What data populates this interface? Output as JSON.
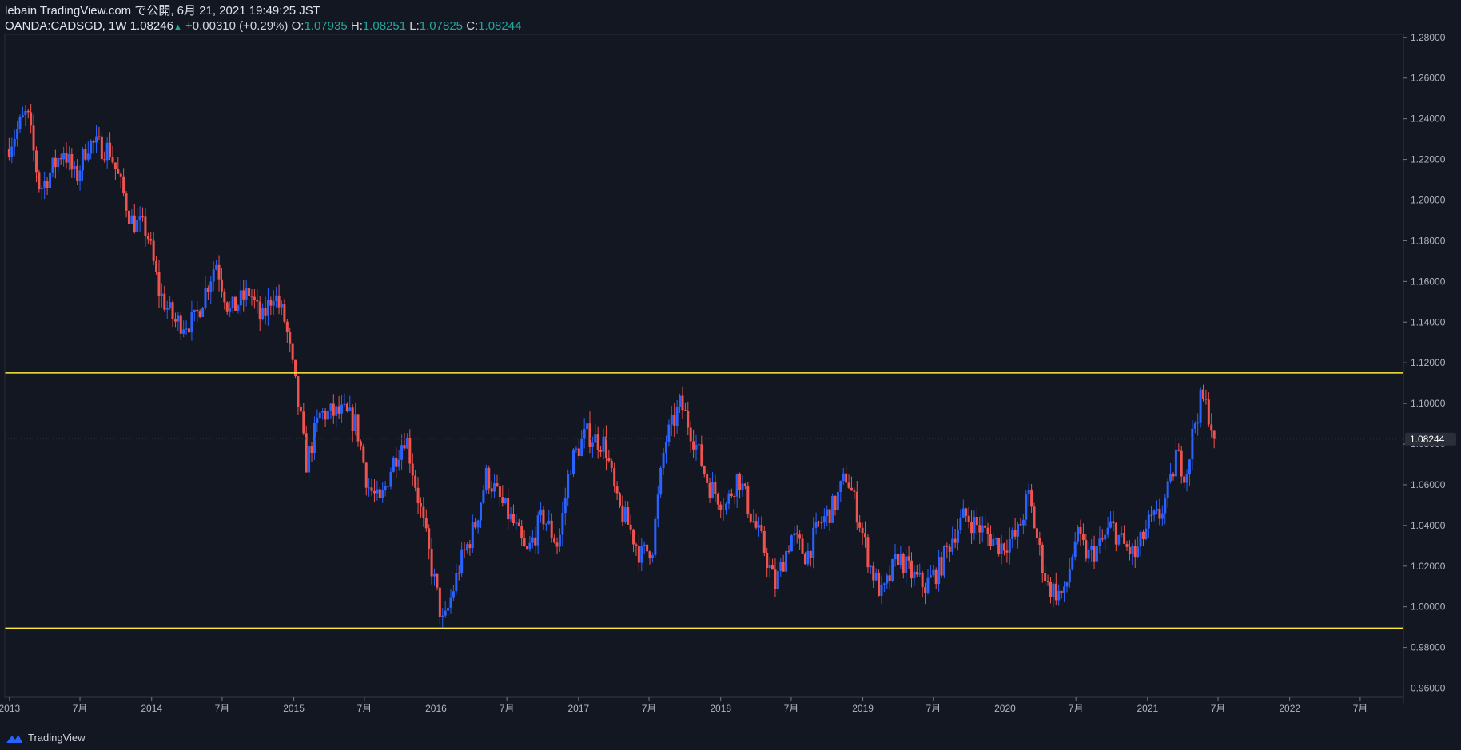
{
  "header": {
    "publish_line": "lebain TradingView.com で公開, 6月 21, 2021 19:49:25 JST",
    "symbol": "OANDA:CADSGD, 1W",
    "last": "1.08246",
    "change": "+0.00310 (+0.29%)",
    "ohlc": [
      {
        "key": "O:",
        "value": "1.07935"
      },
      {
        "key": "H:",
        "value": "1.08251"
      },
      {
        "key": "L:",
        "value": "1.07825"
      },
      {
        "key": "C:",
        "value": "1.08244"
      }
    ]
  },
  "footer": {
    "brand": "TradingView"
  },
  "colors": {
    "background": "#131722",
    "bull": "#2962ff",
    "bear": "#ef5350",
    "level_line": "#ffeb3b",
    "last_price_bg": "#2a2e39"
  },
  "chart_data": {
    "type": "candlestick",
    "x_axis": {
      "labels": [
        "2013",
        "7月",
        "2014",
        "7月",
        "2015",
        "7月",
        "2016",
        "7月",
        "2017",
        "7月",
        "2018",
        "7月",
        "2019",
        "7月",
        "2020",
        "7月",
        "2021",
        "7月",
        "2022",
        "7月"
      ],
      "range": [
        "2012-12-20",
        "2022-10-20"
      ]
    },
    "y_axis": {
      "ticks": [
        "0.96000",
        "0.98000",
        "1.00000",
        "1.02000",
        "1.04000",
        "1.06000",
        "1.08000",
        "1.10000",
        "1.12000",
        "1.14000",
        "1.16000",
        "1.18000",
        "1.20000",
        "1.22000",
        "1.24000",
        "1.26000",
        "1.28000"
      ],
      "range": [
        0.9555,
        1.2815
      ]
    },
    "horizontal_levels": [
      1.115,
      0.9895
    ],
    "last_price": "1.08244",
    "last_price_value": 1.08244,
    "price_path": [
      {
        "date": "2012-12-24",
        "price": 1.225
      },
      {
        "date": "2013-02-15",
        "price": 1.243
      },
      {
        "date": "2013-03-20",
        "price": 1.205
      },
      {
        "date": "2013-05-20",
        "price": 1.225
      },
      {
        "date": "2013-06-20",
        "price": 1.21
      },
      {
        "date": "2013-07-20",
        "price": 1.228
      },
      {
        "date": "2013-09-15",
        "price": 1.225
      },
      {
        "date": "2013-11-10",
        "price": 1.19
      },
      {
        "date": "2013-12-20",
        "price": 1.185
      },
      {
        "date": "2014-01-20",
        "price": 1.155
      },
      {
        "date": "2014-03-01",
        "price": 1.14
      },
      {
        "date": "2014-04-20",
        "price": 1.14
      },
      {
        "date": "2014-06-15",
        "price": 1.17
      },
      {
        "date": "2014-07-20",
        "price": 1.145
      },
      {
        "date": "2014-09-10",
        "price": 1.155
      },
      {
        "date": "2014-10-10",
        "price": 1.14
      },
      {
        "date": "2014-11-10",
        "price": 1.155
      },
      {
        "date": "2014-12-10",
        "price": 1.14
      },
      {
        "date": "2015-01-20",
        "price": 1.09
      },
      {
        "date": "2015-02-01",
        "price": 1.07
      },
      {
        "date": "2015-03-10",
        "price": 1.095
      },
      {
        "date": "2015-05-10",
        "price": 1.095
      },
      {
        "date": "2015-06-10",
        "price": 1.09
      },
      {
        "date": "2015-07-10",
        "price": 1.06
      },
      {
        "date": "2015-08-10",
        "price": 1.05
      },
      {
        "date": "2015-09-10",
        "price": 1.07
      },
      {
        "date": "2015-10-15",
        "price": 1.085
      },
      {
        "date": "2015-11-20",
        "price": 1.05
      },
      {
        "date": "2015-12-20",
        "price": 1.02
      },
      {
        "date": "2016-01-20",
        "price": 0.99
      },
      {
        "date": "2016-03-01",
        "price": 1.02
      },
      {
        "date": "2016-04-10",
        "price": 1.04
      },
      {
        "date": "2016-05-10",
        "price": 1.065
      },
      {
        "date": "2016-06-20",
        "price": 1.05
      },
      {
        "date": "2016-07-20",
        "price": 1.04
      },
      {
        "date": "2016-08-20",
        "price": 1.025
      },
      {
        "date": "2016-10-01",
        "price": 1.045
      },
      {
        "date": "2016-11-10",
        "price": 1.03
      },
      {
        "date": "2016-12-10",
        "price": 1.07
      },
      {
        "date": "2017-01-20",
        "price": 1.085
      },
      {
        "date": "2017-03-10",
        "price": 1.08
      },
      {
        "date": "2017-04-10",
        "price": 1.05
      },
      {
        "date": "2017-05-10",
        "price": 1.04
      },
      {
        "date": "2017-06-10",
        "price": 1.025
      },
      {
        "date": "2017-07-10",
        "price": 1.03
      },
      {
        "date": "2017-08-10",
        "price": 1.08
      },
      {
        "date": "2017-09-20",
        "price": 1.1
      },
      {
        "date": "2017-10-20",
        "price": 1.085
      },
      {
        "date": "2017-12-01",
        "price": 1.06
      },
      {
        "date": "2018-01-15",
        "price": 1.05
      },
      {
        "date": "2018-02-15",
        "price": 1.065
      },
      {
        "date": "2018-03-20",
        "price": 1.045
      },
      {
        "date": "2018-04-20",
        "price": 1.03
      },
      {
        "date": "2018-05-20",
        "price": 1.01
      },
      {
        "date": "2018-07-01",
        "price": 1.035
      },
      {
        "date": "2018-08-10",
        "price": 1.025
      },
      {
        "date": "2018-09-10",
        "price": 1.04
      },
      {
        "date": "2018-10-20",
        "price": 1.05
      },
      {
        "date": "2018-11-20",
        "price": 1.065
      },
      {
        "date": "2018-12-20",
        "price": 1.045
      },
      {
        "date": "2019-01-20",
        "price": 1.02
      },
      {
        "date": "2019-02-20",
        "price": 1.005
      },
      {
        "date": "2019-04-01",
        "price": 1.025
      },
      {
        "date": "2019-05-10",
        "price": 1.015
      },
      {
        "date": "2019-06-10",
        "price": 1.01
      },
      {
        "date": "2019-07-20",
        "price": 1.02
      },
      {
        "date": "2019-08-20",
        "price": 1.035
      },
      {
        "date": "2019-09-20",
        "price": 1.045
      },
      {
        "date": "2019-10-20",
        "price": 1.04
      },
      {
        "date": "2019-11-20",
        "price": 1.035
      },
      {
        "date": "2019-12-20",
        "price": 1.03
      },
      {
        "date": "2020-02-01",
        "price": 1.035
      },
      {
        "date": "2020-03-01",
        "price": 1.055
      },
      {
        "date": "2020-04-01",
        "price": 1.025
      },
      {
        "date": "2020-04-20",
        "price": 1.01
      },
      {
        "date": "2020-06-01",
        "price": 1.005
      },
      {
        "date": "2020-07-01",
        "price": 1.035
      },
      {
        "date": "2020-08-01",
        "price": 1.025
      },
      {
        "date": "2020-09-01",
        "price": 1.03
      },
      {
        "date": "2020-10-01",
        "price": 1.04
      },
      {
        "date": "2020-11-01",
        "price": 1.03
      },
      {
        "date": "2020-12-01",
        "price": 1.025
      },
      {
        "date": "2021-01-01",
        "price": 1.04
      },
      {
        "date": "2021-02-01",
        "price": 1.045
      },
      {
        "date": "2021-03-01",
        "price": 1.06
      },
      {
        "date": "2021-03-15",
        "price": 1.075
      },
      {
        "date": "2021-04-10",
        "price": 1.065
      },
      {
        "date": "2021-05-01",
        "price": 1.09
      },
      {
        "date": "2021-05-20",
        "price": 1.103
      },
      {
        "date": "2021-06-10",
        "price": 1.094
      },
      {
        "date": "2021-06-21",
        "price": 1.0824
      }
    ]
  }
}
